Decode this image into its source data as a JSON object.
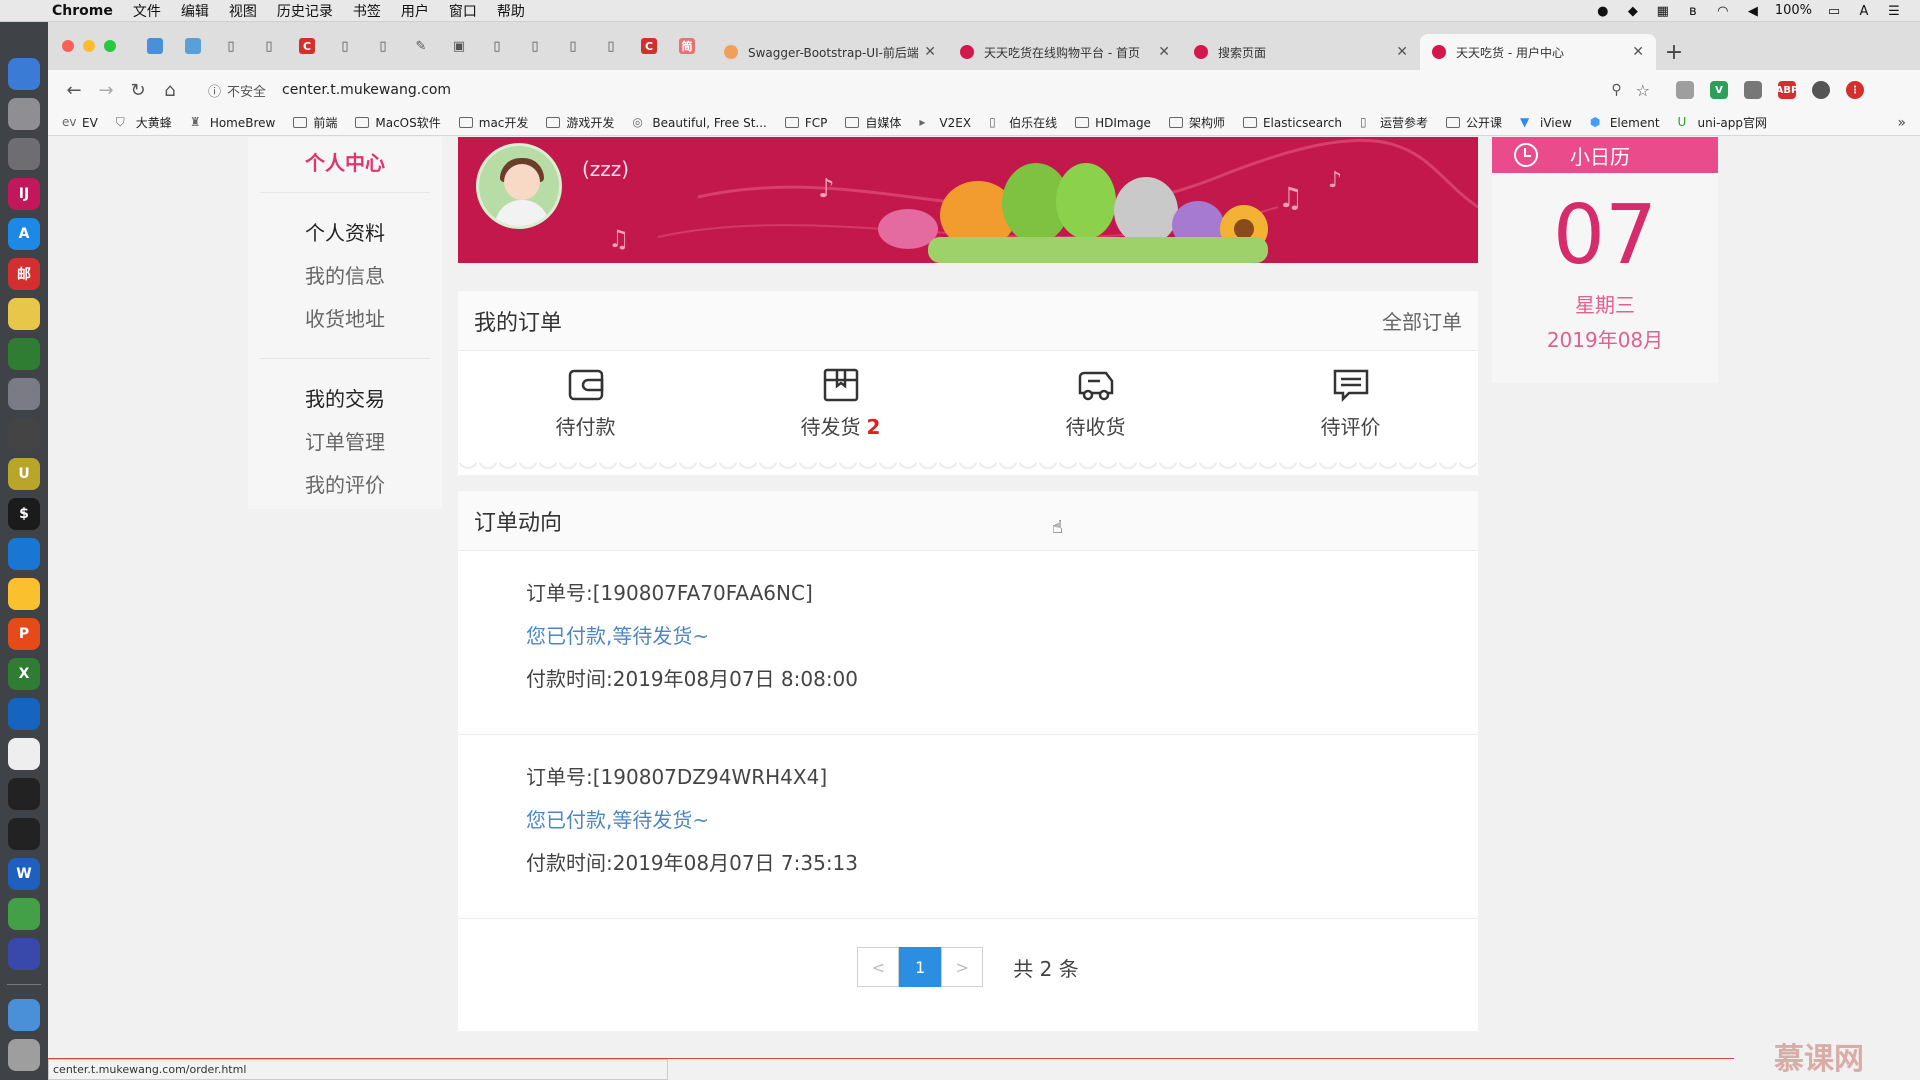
{
  "menubar": {
    "app": "Chrome",
    "items": [
      "文件",
      "编辑",
      "视图",
      "历史记录",
      "书签",
      "用户",
      "窗口",
      "帮助"
    ],
    "battery": "100%"
  },
  "browser": {
    "tabs": [
      {
        "title": "Swagger-Bootstrap-UI-前后端",
        "favicon_color": "#f0a05a"
      },
      {
        "title": "天天吃货在线购物平台 - 首页",
        "favicon_color": "#d4184b"
      },
      {
        "title": "搜索页面",
        "favicon_color": "#d4184b"
      },
      {
        "title": "天天吃货 - 用户中心",
        "favicon_color": "#d4184b",
        "active": true
      }
    ],
    "address": {
      "security_label": "不安全",
      "url": "center.t.mukewang.com"
    },
    "bookmarks": [
      "EV",
      "大黄蜂",
      "HomeBrew",
      "前端",
      "MacOS软件",
      "mac开发",
      "游戏开发",
      "Beautiful, Free St...",
      "FCP",
      "自媒体",
      "V2EX",
      "伯乐在线",
      "HDImage",
      "架构师",
      "Elasticsearch",
      "运营参考",
      "公开课",
      "iView",
      "Element",
      "uni-app官网"
    ],
    "more": "»"
  },
  "sidebar": {
    "heading": "个人中心",
    "groups": [
      {
        "title": "个人资料",
        "items": [
          "我的信息",
          "收货地址"
        ]
      },
      {
        "title": "我的交易",
        "items": [
          "订单管理",
          "我的评价"
        ]
      }
    ]
  },
  "profile": {
    "nickname": "(zzz)"
  },
  "my_orders": {
    "title": "我的订单",
    "all_link": "全部订单",
    "statuses": [
      {
        "label": "待付款",
        "icon": "wallet-icon",
        "count": ""
      },
      {
        "label": "待发货",
        "icon": "package-icon",
        "count": "2"
      },
      {
        "label": "待收货",
        "icon": "truck-icon",
        "count": ""
      },
      {
        "label": "待评价",
        "icon": "comment-icon",
        "count": ""
      }
    ]
  },
  "order_trends": {
    "title": "订单动向",
    "orders": [
      {
        "number_label": "订单号:",
        "number": "[190807FA70FAA6NC]",
        "status": "您已付款,等待发货~",
        "time_label": "付款时间:",
        "time": "2019年08月07日 8:08:00"
      },
      {
        "number_label": "订单号:",
        "number": "[190807DZ94WRH4X4]",
        "status": "您已付款,等待发货~",
        "time_label": "付款时间:",
        "time": "2019年08月07日 7:35:13"
      }
    ],
    "pager": {
      "prev": "<",
      "current": "1",
      "next": ">",
      "total": "共 2 条"
    }
  },
  "calendar": {
    "title": "小日历",
    "day": "07",
    "weekday": "星期三",
    "month": "2019年08月"
  },
  "statusbar_url": "center.t.mukewang.com/order.html",
  "watermark": "慕课网",
  "colors": {
    "brand": "#d4184b",
    "sidebar_heading": "#e0336f",
    "calendar_accent": "#ea4b8a",
    "link_blue": "#4e86c1",
    "pager_active": "#2b8ee0",
    "badge_red": "#e02020"
  }
}
